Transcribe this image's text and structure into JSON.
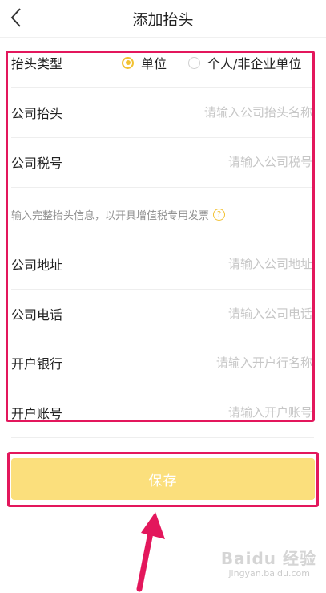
{
  "header": {
    "title": "添加抬头"
  },
  "form": {
    "type_row": {
      "label": "抬头类型",
      "options": [
        {
          "label": "单位",
          "checked": true
        },
        {
          "label": "个人/非企业单位",
          "checked": false
        }
      ]
    },
    "fields_top": [
      {
        "label": "公司抬头",
        "placeholder": "请输入公司抬头名称",
        "value": ""
      },
      {
        "label": "公司税号",
        "placeholder": "请输入公司税号",
        "value": ""
      }
    ],
    "hint": "输入完整抬头信息，以开具增值税专用发票",
    "fields_bottom": [
      {
        "label": "公司地址",
        "placeholder": "请输入公司地址",
        "value": ""
      },
      {
        "label": "公司电话",
        "placeholder": "请输入公司电话",
        "value": ""
      },
      {
        "label": "开户银行",
        "placeholder": "请输入开户行名称",
        "value": ""
      },
      {
        "label": "开户账号",
        "placeholder": "请输入开户账号",
        "value": ""
      }
    ]
  },
  "save_button": {
    "label": "保存"
  },
  "watermark": {
    "brand": "Baidu 经验",
    "url": "jingyan.baidu.com"
  },
  "colors": {
    "accent": "#f2c131",
    "save_bg": "#fbdf7c",
    "annotation": "#e3175c"
  },
  "icons": {
    "back": "chevron-left-icon",
    "help": "question-circle-icon",
    "arrow": "up-arrow-annotation"
  }
}
